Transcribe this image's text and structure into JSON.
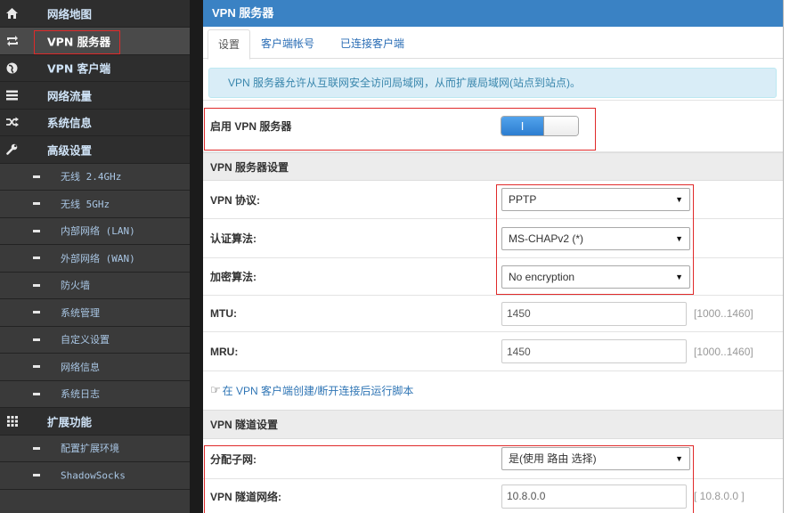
{
  "colors": {
    "header_bg": "#3a82c4",
    "sidebar_bg": "#2e2e2e",
    "sidebar_sub_bg": "#3a3a3a",
    "info_bg": "#d9edf7",
    "info_text": "#3a87ad",
    "link": "#2f75b5",
    "toggle_on": "#3a8ede",
    "annotation": "#e02a2a"
  },
  "sidebar": {
    "items": [
      {
        "label": "网络地图",
        "icon": "home-icon"
      },
      {
        "label": "VPN 服务器",
        "icon": "retweet-icon",
        "selected": true
      },
      {
        "label": "VPN 客户端",
        "icon": "globe-icon"
      },
      {
        "label": "网络流量",
        "icon": "list-icon"
      },
      {
        "label": "系统信息",
        "icon": "shuffle-icon"
      },
      {
        "label": "高级设置",
        "icon": "wrench-icon"
      },
      {
        "label": "无线 2.4GHz",
        "icon": "dash-icon"
      },
      {
        "label": "无线 5GHz",
        "icon": "dash-icon"
      },
      {
        "label": "内部网络 (LAN)",
        "icon": "dash-icon"
      },
      {
        "label": "外部网络 (WAN)",
        "icon": "dash-icon"
      },
      {
        "label": "防火墙",
        "icon": "dash-icon"
      },
      {
        "label": "系统管理",
        "icon": "dash-icon"
      },
      {
        "label": "自定义设置",
        "icon": "dash-icon"
      },
      {
        "label": "网络信息",
        "icon": "dash-icon"
      },
      {
        "label": "系统日志",
        "icon": "dash-icon"
      },
      {
        "label": "扩展功能",
        "icon": "grid-icon"
      },
      {
        "label": "配置扩展环境",
        "icon": "dash-icon"
      },
      {
        "label": "ShadowSocks",
        "icon": "dash-icon"
      }
    ]
  },
  "header": {
    "title": "VPN 服务器"
  },
  "tabs": [
    {
      "label": "设置",
      "active": true
    },
    {
      "label": "客户端帐号"
    },
    {
      "label": "已连接客户端"
    }
  ],
  "info_text": "VPN 服务器允许从互联网安全访问局域网，从而扩展局域网(站点到站点)。",
  "enable_server": {
    "label": "启用 VPN 服务器",
    "switch_on_text": "I",
    "enabled": true
  },
  "server_settings": {
    "title": "VPN 服务器设置",
    "protocol": {
      "label": "VPN 协议:",
      "value": "PPTP"
    },
    "auth": {
      "label": "认证算法:",
      "value": "MS-CHAPv2 (*)"
    },
    "encryption": {
      "label": "加密算法:",
      "value": "No encryption"
    },
    "mtu": {
      "label": "MTU:",
      "value": "1450",
      "range": "[1000..1460]"
    },
    "mru": {
      "label": "MRU:",
      "value": "1450",
      "range": "[1000..1460]"
    },
    "script_link": "在 VPN 客户端创建/断开连接后运行脚本"
  },
  "tunnel_settings": {
    "title": "VPN 隧道设置",
    "subnet": {
      "label": "分配子网:",
      "value": "是(使用 路由 选择)"
    },
    "network": {
      "label": "VPN 隧道网络:",
      "value": "10.8.0.0",
      "hint": "[ 10.8.0.0 ]"
    }
  }
}
